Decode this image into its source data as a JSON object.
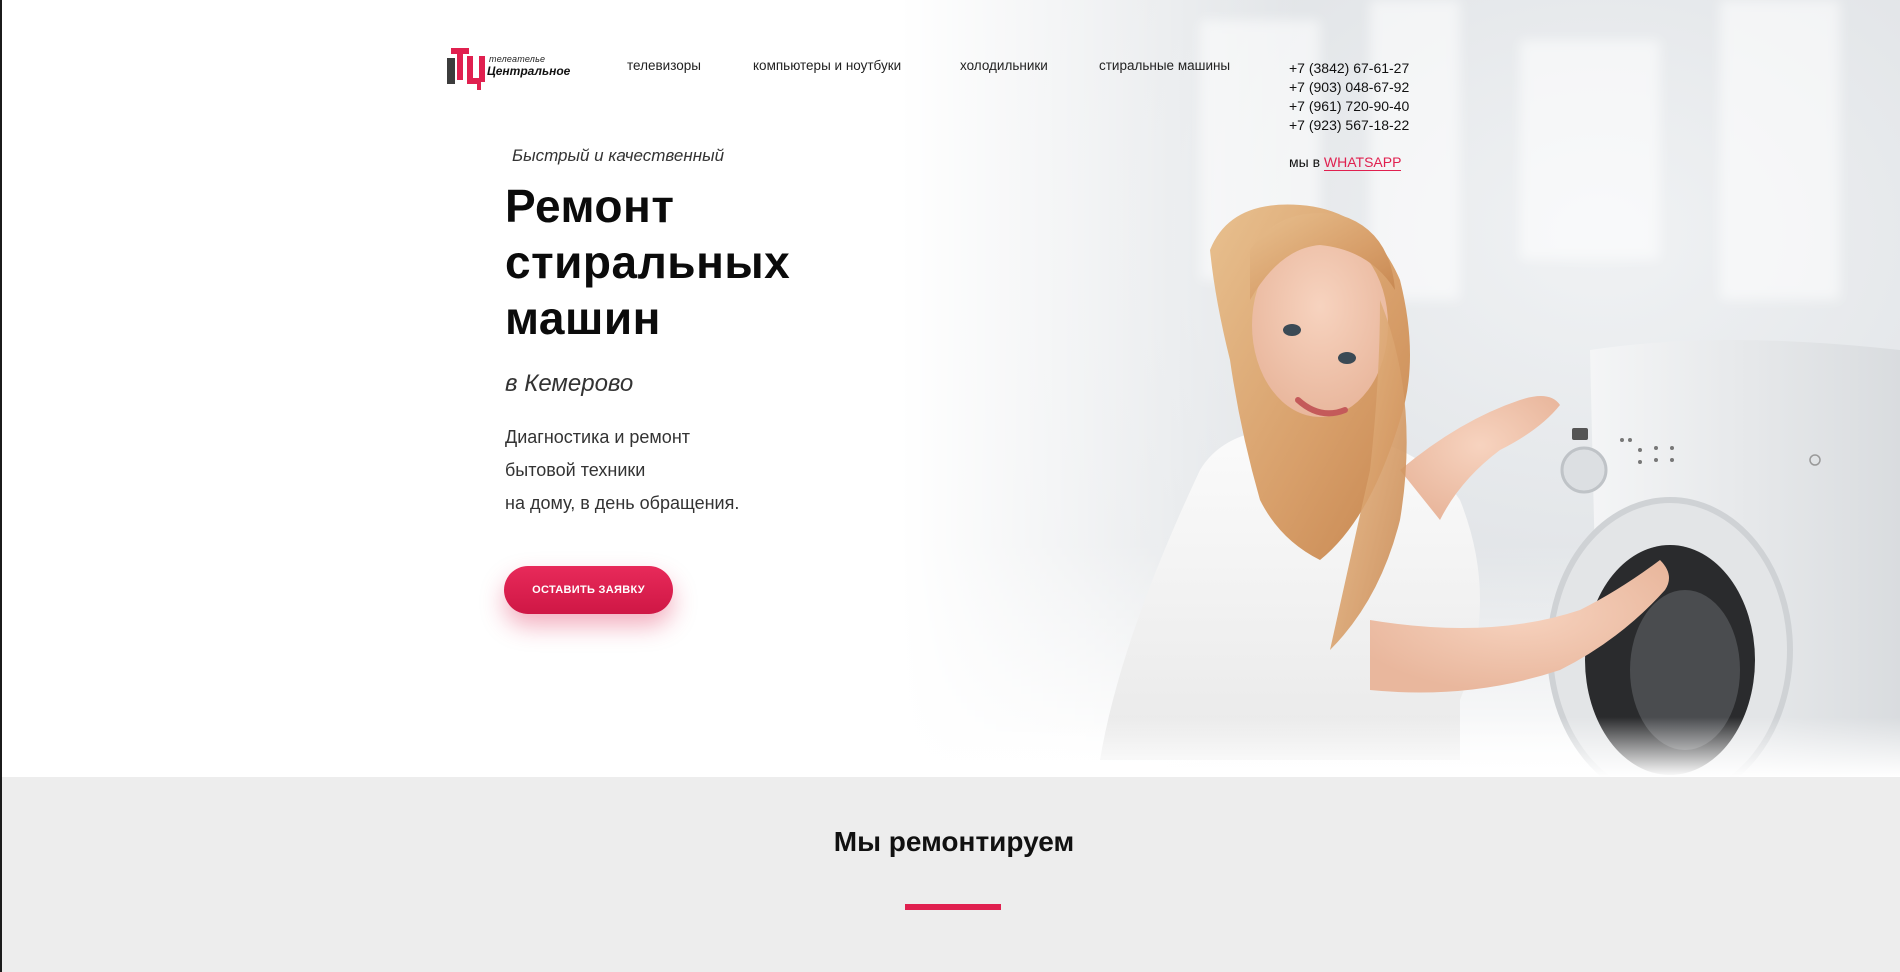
{
  "brand": {
    "small_text": "телеателье",
    "name": "Центральное",
    "accent_color": "#e0204f"
  },
  "nav": {
    "items": [
      {
        "label": "телевизоры"
      },
      {
        "label": "компьютеры и ноутбуки"
      },
      {
        "label": "холодильники"
      },
      {
        "label": "стиральные машины"
      }
    ]
  },
  "contacts": {
    "phones": [
      "+7 (3842) 67-61-27",
      "+7 (903) 048-67-92",
      "+7 (961) 720-90-40",
      "+7 (923) 567-18-22"
    ],
    "whatsapp_prefix": "мы в",
    "whatsapp_label": "WHATSAPP"
  },
  "hero": {
    "eyebrow": "Быстрый и качественный",
    "headline_lines": [
      "Ремонт",
      "стиральных",
      "машин"
    ],
    "city": "в Кемерово",
    "description_lines": [
      "Диагностика и ремонт",
      "бытовой техники",
      "на дому, в день обращения."
    ],
    "cta_label": "ОСТАВИТЬ ЗАЯВКУ",
    "photo_icon": "woman-with-washing-machine-photo"
  },
  "section_repair": {
    "title": "Мы ремонтируем"
  }
}
